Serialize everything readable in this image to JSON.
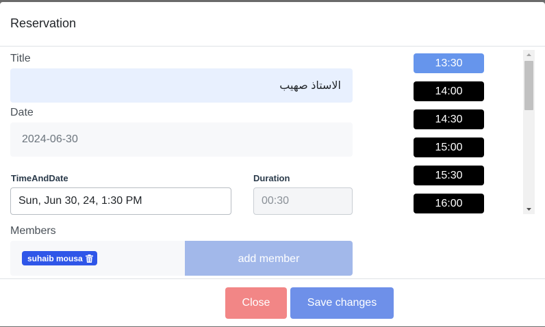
{
  "modal": {
    "title": "Reservation",
    "title_label": "Title",
    "title_value": "الاستاذ صهيب",
    "date_label": "Date",
    "date_value": "2024-06-30",
    "time_and_date_label": "TimeAndDate",
    "time_and_date_value": "Sun, Jun 30, 24, 1:30 PM",
    "duration_label": "Duration",
    "duration_value": "00:30",
    "members_label": "Members",
    "members": [
      {
        "name": "suhaib mousa",
        "icon": "trash-icon"
      }
    ],
    "add_member_label": "add member",
    "time_slots": [
      "13:30",
      "14:00",
      "14:30",
      "15:00",
      "15:30",
      "16:00"
    ],
    "selected_slot": "13:30",
    "close_label": "Close",
    "save_label": "Save changes"
  },
  "colors": {
    "selected_slot": "#6695ec",
    "slot": "#000000",
    "member_chip": "#2f56e8",
    "add_member": "#a2b8ea",
    "close_button": "#f28686",
    "save_button": "#6e90e9"
  }
}
